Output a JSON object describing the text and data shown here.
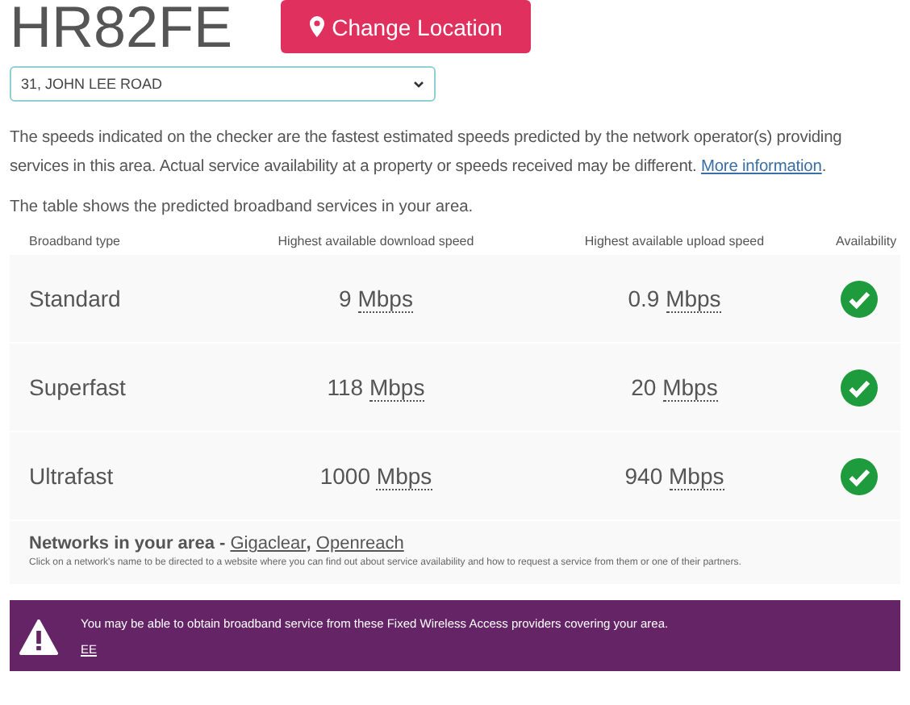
{
  "postcode": "HR82FE",
  "change_button": "Change Location",
  "address_select": {
    "value": "31, JOHN LEE ROAD"
  },
  "intro": {
    "text": "The speeds indicated on the checker are the fastest estimated speeds predicted by the network operator(s) providing services in this area. Actual service availability at a property or speeds received may be different.",
    "link": "More information",
    "after": "."
  },
  "table_intro": "The table shows the predicted broadband services in your area.",
  "table": {
    "columns": [
      "Broadband type",
      "Highest available download speed",
      "Highest available upload speed",
      "Availability"
    ],
    "rows": [
      {
        "type": "Standard",
        "download": "9",
        "download_unit": "Mbps",
        "upload": "0.9",
        "upload_unit": "Mbps",
        "available": true
      },
      {
        "type": "Superfast",
        "download": "118",
        "download_unit": "Mbps",
        "upload": "20",
        "upload_unit": "Mbps",
        "available": true
      },
      {
        "type": "Ultrafast",
        "download": "1000",
        "download_unit": "Mbps",
        "upload": "940",
        "upload_unit": "Mbps",
        "available": true
      }
    ]
  },
  "networks": {
    "label": "Networks in your area - ",
    "links": [
      "Gigaclear",
      "Openreach"
    ],
    "separator": ", ",
    "note": "Click on a network's name to be directed to a website where you can find out about service availability and how to request a service from them or one of their partners."
  },
  "alert": {
    "text": "You may be able to obtain broadband service from these Fixed Wireless Access providers covering your area.",
    "links": [
      "EE"
    ]
  }
}
